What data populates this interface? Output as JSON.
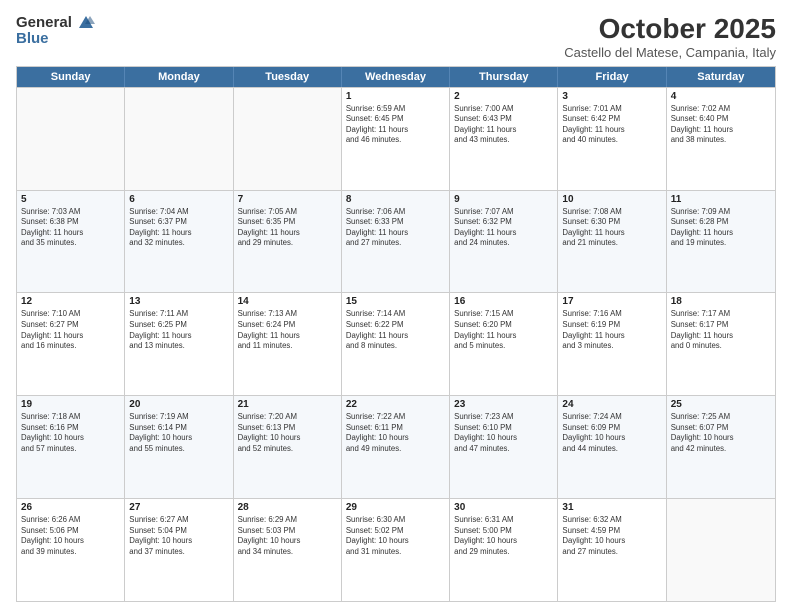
{
  "header": {
    "logo_general": "General",
    "logo_blue": "Blue",
    "month_title": "October 2025",
    "location": "Castello del Matese, Campania, Italy"
  },
  "days_of_week": [
    "Sunday",
    "Monday",
    "Tuesday",
    "Wednesday",
    "Thursday",
    "Friday",
    "Saturday"
  ],
  "weeks": [
    [
      {
        "day": "",
        "info": ""
      },
      {
        "day": "",
        "info": ""
      },
      {
        "day": "",
        "info": ""
      },
      {
        "day": "1",
        "info": "Sunrise: 6:59 AM\nSunset: 6:45 PM\nDaylight: 11 hours\nand 46 minutes."
      },
      {
        "day": "2",
        "info": "Sunrise: 7:00 AM\nSunset: 6:43 PM\nDaylight: 11 hours\nand 43 minutes."
      },
      {
        "day": "3",
        "info": "Sunrise: 7:01 AM\nSunset: 6:42 PM\nDaylight: 11 hours\nand 40 minutes."
      },
      {
        "day": "4",
        "info": "Sunrise: 7:02 AM\nSunset: 6:40 PM\nDaylight: 11 hours\nand 38 minutes."
      }
    ],
    [
      {
        "day": "5",
        "info": "Sunrise: 7:03 AM\nSunset: 6:38 PM\nDaylight: 11 hours\nand 35 minutes."
      },
      {
        "day": "6",
        "info": "Sunrise: 7:04 AM\nSunset: 6:37 PM\nDaylight: 11 hours\nand 32 minutes."
      },
      {
        "day": "7",
        "info": "Sunrise: 7:05 AM\nSunset: 6:35 PM\nDaylight: 11 hours\nand 29 minutes."
      },
      {
        "day": "8",
        "info": "Sunrise: 7:06 AM\nSunset: 6:33 PM\nDaylight: 11 hours\nand 27 minutes."
      },
      {
        "day": "9",
        "info": "Sunrise: 7:07 AM\nSunset: 6:32 PM\nDaylight: 11 hours\nand 24 minutes."
      },
      {
        "day": "10",
        "info": "Sunrise: 7:08 AM\nSunset: 6:30 PM\nDaylight: 11 hours\nand 21 minutes."
      },
      {
        "day": "11",
        "info": "Sunrise: 7:09 AM\nSunset: 6:28 PM\nDaylight: 11 hours\nand 19 minutes."
      }
    ],
    [
      {
        "day": "12",
        "info": "Sunrise: 7:10 AM\nSunset: 6:27 PM\nDaylight: 11 hours\nand 16 minutes."
      },
      {
        "day": "13",
        "info": "Sunrise: 7:11 AM\nSunset: 6:25 PM\nDaylight: 11 hours\nand 13 minutes."
      },
      {
        "day": "14",
        "info": "Sunrise: 7:13 AM\nSunset: 6:24 PM\nDaylight: 11 hours\nand 11 minutes."
      },
      {
        "day": "15",
        "info": "Sunrise: 7:14 AM\nSunset: 6:22 PM\nDaylight: 11 hours\nand 8 minutes."
      },
      {
        "day": "16",
        "info": "Sunrise: 7:15 AM\nSunset: 6:20 PM\nDaylight: 11 hours\nand 5 minutes."
      },
      {
        "day": "17",
        "info": "Sunrise: 7:16 AM\nSunset: 6:19 PM\nDaylight: 11 hours\nand 3 minutes."
      },
      {
        "day": "18",
        "info": "Sunrise: 7:17 AM\nSunset: 6:17 PM\nDaylight: 11 hours\nand 0 minutes."
      }
    ],
    [
      {
        "day": "19",
        "info": "Sunrise: 7:18 AM\nSunset: 6:16 PM\nDaylight: 10 hours\nand 57 minutes."
      },
      {
        "day": "20",
        "info": "Sunrise: 7:19 AM\nSunset: 6:14 PM\nDaylight: 10 hours\nand 55 minutes."
      },
      {
        "day": "21",
        "info": "Sunrise: 7:20 AM\nSunset: 6:13 PM\nDaylight: 10 hours\nand 52 minutes."
      },
      {
        "day": "22",
        "info": "Sunrise: 7:22 AM\nSunset: 6:11 PM\nDaylight: 10 hours\nand 49 minutes."
      },
      {
        "day": "23",
        "info": "Sunrise: 7:23 AM\nSunset: 6:10 PM\nDaylight: 10 hours\nand 47 minutes."
      },
      {
        "day": "24",
        "info": "Sunrise: 7:24 AM\nSunset: 6:09 PM\nDaylight: 10 hours\nand 44 minutes."
      },
      {
        "day": "25",
        "info": "Sunrise: 7:25 AM\nSunset: 6:07 PM\nDaylight: 10 hours\nand 42 minutes."
      }
    ],
    [
      {
        "day": "26",
        "info": "Sunrise: 6:26 AM\nSunset: 5:06 PM\nDaylight: 10 hours\nand 39 minutes."
      },
      {
        "day": "27",
        "info": "Sunrise: 6:27 AM\nSunset: 5:04 PM\nDaylight: 10 hours\nand 37 minutes."
      },
      {
        "day": "28",
        "info": "Sunrise: 6:29 AM\nSunset: 5:03 PM\nDaylight: 10 hours\nand 34 minutes."
      },
      {
        "day": "29",
        "info": "Sunrise: 6:30 AM\nSunset: 5:02 PM\nDaylight: 10 hours\nand 31 minutes."
      },
      {
        "day": "30",
        "info": "Sunrise: 6:31 AM\nSunset: 5:00 PM\nDaylight: 10 hours\nand 29 minutes."
      },
      {
        "day": "31",
        "info": "Sunrise: 6:32 AM\nSunset: 4:59 PM\nDaylight: 10 hours\nand 27 minutes."
      },
      {
        "day": "",
        "info": ""
      }
    ]
  ]
}
